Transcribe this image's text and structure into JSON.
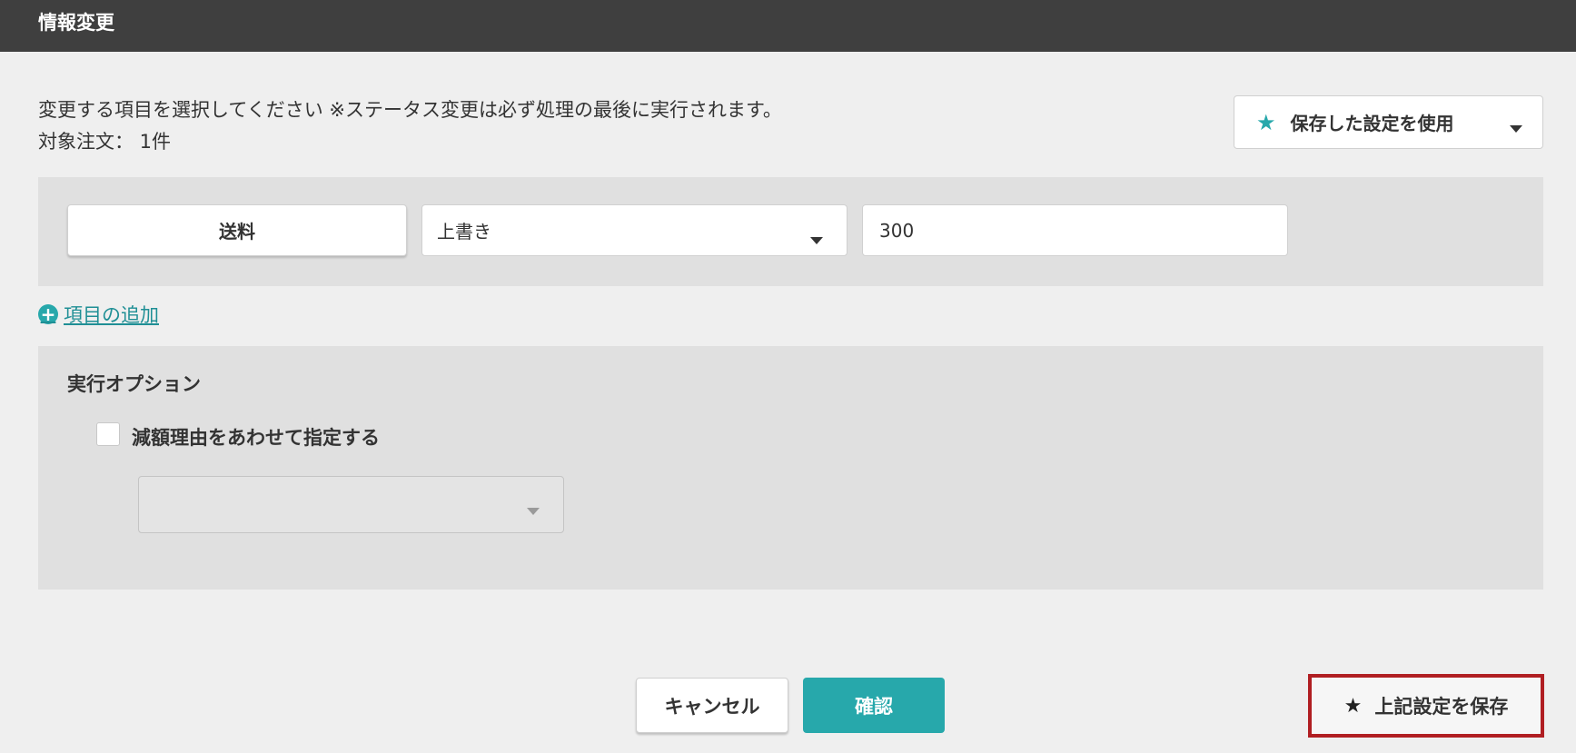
{
  "window": {
    "title": "情報変更"
  },
  "header": {
    "description": "変更する項目を選択してください ※ステータス変更は必ず処理の最後に実行されます。",
    "target_label": "対象注文： 1件"
  },
  "saved_settings": {
    "label": "保存した設定を使用",
    "icon": "star-icon",
    "icon_color": "#27a8ab"
  },
  "change_row": {
    "field_label": "送料",
    "mode_value": "上書き",
    "input_value": "300"
  },
  "add_item": {
    "label": "項目の追加",
    "icon": "plus-circle-icon"
  },
  "options": {
    "title": "実行オプション",
    "checkbox_label": "減額理由をあわせて指定する",
    "checkbox_checked": false,
    "reason_select_value": ""
  },
  "footer": {
    "cancel_label": "キャンセル",
    "confirm_label": "確認",
    "save_label": "上記設定を保存"
  },
  "colors": {
    "accent": "#27a8ab",
    "titlebar": "#3f3f3f",
    "highlight_border": "#b01e22"
  }
}
